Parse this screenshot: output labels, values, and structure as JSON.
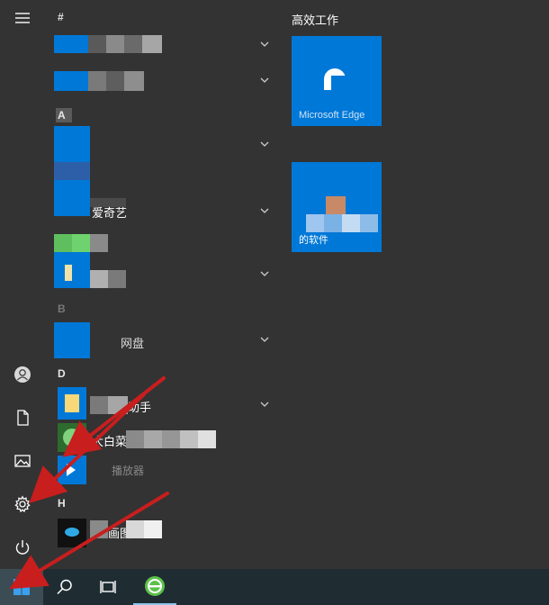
{
  "start_menu": {
    "sections": {
      "hash": "#",
      "a": "A",
      "b": "B",
      "d": "D",
      "h": "H"
    },
    "apps": {
      "iqiyi_label": "爱奇艺",
      "netdisk_label": "网盘",
      "d1_label": "助手",
      "d2_label": "大白菜",
      "d3_label": "播放器",
      "h1_label": "画图"
    },
    "tiles": {
      "group_title": "高效工作",
      "edge_label": "Microsoft Edge",
      "software_label": "的软件"
    }
  },
  "rail": {
    "icons": [
      "hamburger-icon",
      "user-icon",
      "document-icon",
      "pictures-icon",
      "settings-icon",
      "power-icon"
    ]
  },
  "taskbar": {
    "icons": [
      "windows-start-icon",
      "search-icon",
      "task-view-icon",
      "browser-app-icon"
    ]
  },
  "colors": {
    "accent": "#0078d7",
    "menu_bg": "#333333",
    "taskbar_bg": "#1f2d33",
    "arrow": "#c81e1e"
  }
}
